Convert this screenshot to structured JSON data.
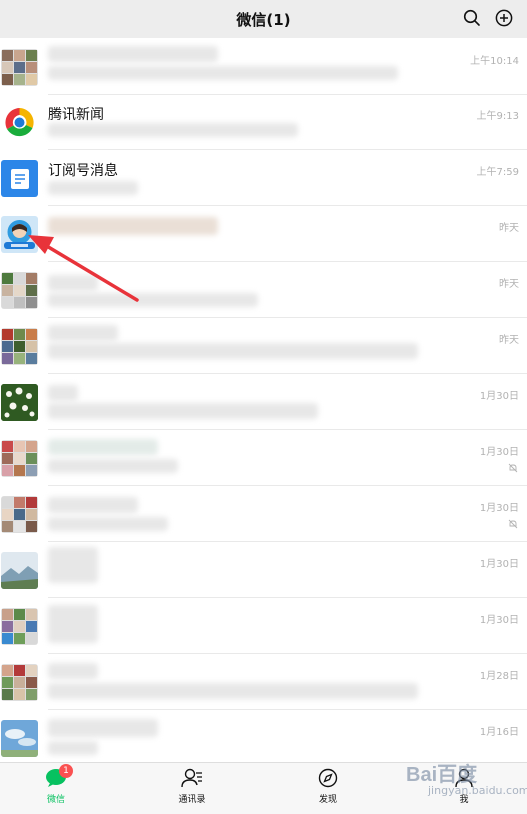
{
  "header": {
    "title": "微信(1)",
    "search_icon": "search-icon",
    "add_icon": "plus-circle-icon"
  },
  "chats": [
    {
      "name": "",
      "time": "上午10:14",
      "avatar": "group-grid",
      "muted": false
    },
    {
      "name": "腾讯新闻",
      "time": "上午9:13",
      "avatar": "tencent-news-logo",
      "muted": false
    },
    {
      "name": "订阅号消息",
      "time": "上午7:59",
      "avatar": "subscription-icon",
      "muted": false
    },
    {
      "name": "",
      "time": "昨天",
      "avatar": "profile-photo",
      "muted": false
    },
    {
      "name": "",
      "time": "昨天",
      "avatar": "group-grid",
      "muted": false
    },
    {
      "name": "",
      "time": "昨天",
      "avatar": "group-grid",
      "muted": false
    },
    {
      "name": "",
      "time": "1月30日",
      "avatar": "flowers-photo",
      "muted": false
    },
    {
      "name": "",
      "time": "1月30日",
      "avatar": "group-grid",
      "muted": true
    },
    {
      "name": "",
      "time": "1月30日",
      "avatar": "group-grid",
      "muted": true
    },
    {
      "name": "",
      "time": "1月30日",
      "avatar": "landscape-photo",
      "muted": false
    },
    {
      "name": "",
      "time": "1月30日",
      "avatar": "group-grid",
      "muted": false
    },
    {
      "name": "",
      "time": "1月28日",
      "avatar": "group-grid",
      "muted": false
    },
    {
      "name": "",
      "time": "1月16日",
      "avatar": "sky-photo",
      "muted": false
    }
  ],
  "tabbar": {
    "tabs": [
      {
        "label": "微信",
        "icon": "chat-bubble-icon",
        "active": true
      },
      {
        "label": "通讯录",
        "icon": "contacts-icon",
        "active": false
      },
      {
        "label": "发现",
        "icon": "compass-icon",
        "active": false
      },
      {
        "label": "我",
        "icon": "person-icon",
        "active": false
      }
    ],
    "badge": "1"
  },
  "watermark": {
    "brand": "Bai百度",
    "sub": "jingyan.baidu.com"
  },
  "annotation": {
    "color": "#e8333a"
  },
  "colors": {
    "accent": "#07c160",
    "badge": "#fa5151",
    "time": "#b2b2b2"
  }
}
